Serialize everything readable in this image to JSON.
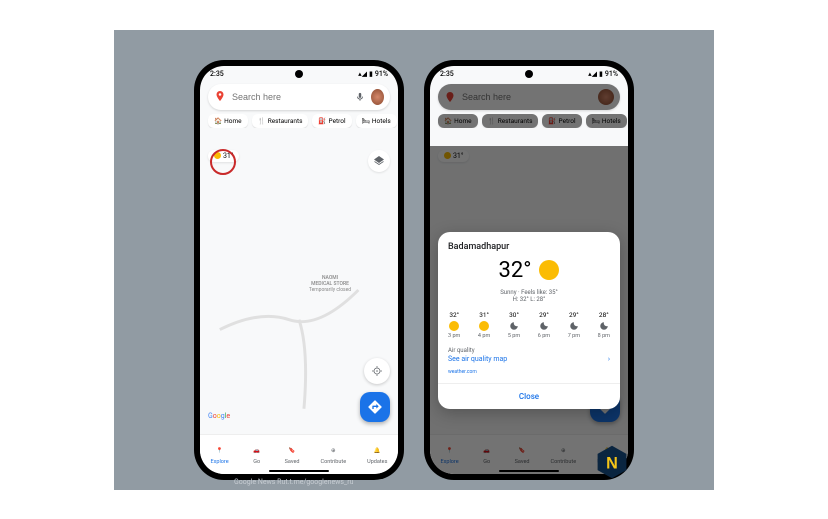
{
  "status": {
    "time": "2:35",
    "battery": "91%"
  },
  "search": {
    "placeholder": "Search here"
  },
  "chips": [
    {
      "icon": "home",
      "label": "Home"
    },
    {
      "icon": "restaurant",
      "label": "Restaurants"
    },
    {
      "icon": "petrol",
      "label": "Petrol"
    },
    {
      "icon": "hotel",
      "label": "Hotels"
    }
  ],
  "weather_pill": {
    "temp": "31°"
  },
  "poi": {
    "name": "NAOMI\nMEDICAL STORE",
    "sub": "Temporarily closed"
  },
  "attribution": "Google",
  "nav": [
    {
      "label": "Explore",
      "active": true
    },
    {
      "label": "Go"
    },
    {
      "label": "Saved"
    },
    {
      "label": "Contribute"
    },
    {
      "label": "Updates"
    }
  ],
  "weather_card": {
    "location": "Badamadhapur",
    "temp": "32°",
    "condition": "Sunny · Feels like: 35°",
    "hilo": "H: 32° L: 28°",
    "hourly": [
      {
        "temp": "32°",
        "icon": "sun",
        "time": "3 pm"
      },
      {
        "temp": "31°",
        "icon": "sun",
        "time": "4 pm"
      },
      {
        "temp": "30°",
        "icon": "moon",
        "time": "5 pm"
      },
      {
        "temp": "29°",
        "icon": "moon",
        "time": "6 pm"
      },
      {
        "temp": "29°",
        "icon": "moon",
        "time": "7 pm"
      },
      {
        "temp": "28°",
        "icon": "moon",
        "time": "8 pm"
      }
    ],
    "aq_label": "Air quality",
    "aq_link": "See air quality map",
    "source": "weather.com",
    "close": "Close"
  },
  "credit": "Google News   Rut.t.me/googlenews_ru"
}
